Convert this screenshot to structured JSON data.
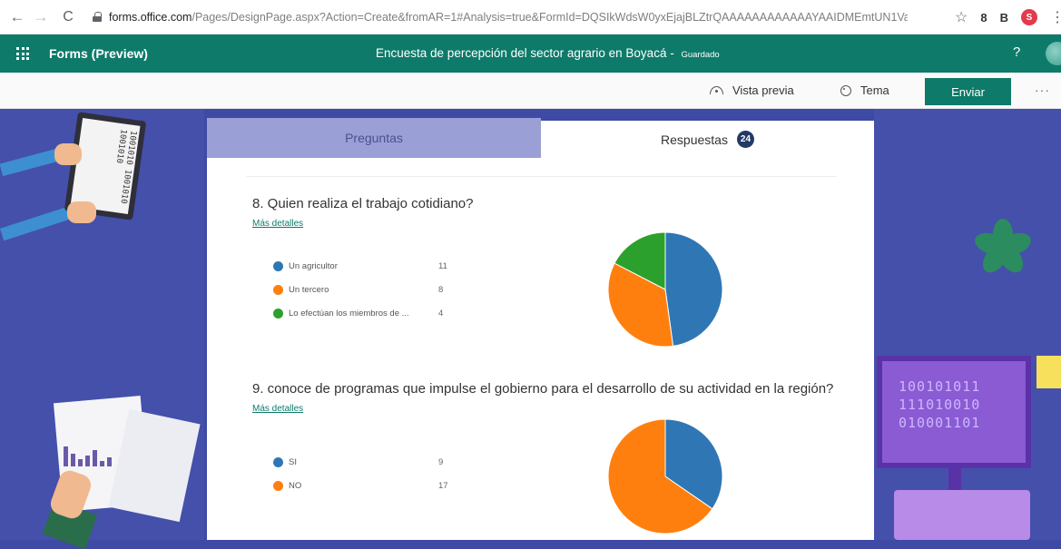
{
  "browser": {
    "url_host": "forms.office.com",
    "url_path": "/Pages/DesignPage.aspx?Action=Create&fromAR=1#Analysis=true&FormId=DQSIkWdsW0yxEjajBLZtrQAAAAAAAAAAAAYAAIDMEmtUN1VaTDhU...",
    "profile_initial": "S",
    "ext_label": "B"
  },
  "forms_bar": {
    "app_name": "Forms (Preview)",
    "title": "Encuesta de percepción del sector agrario en Boyacá",
    "separator": " - ",
    "saved": "Guardado",
    "help": "?"
  },
  "command_bar": {
    "preview": "Vista previa",
    "theme": "Tema",
    "send": "Enviar",
    "more": "···"
  },
  "tabs": {
    "questions": "Preguntas",
    "responses": "Respuestas",
    "responses_count": "24"
  },
  "decor": {
    "tablet_text": "1001010 1001010 1001010",
    "monitor_lines": [
      "100101011",
      "111010010",
      "010001101"
    ]
  },
  "questions": [
    {
      "title": "8.  Quien realiza el trabajo cotidiano?",
      "details_link": "Más detalles",
      "options": [
        {
          "label": "Un agricultor",
          "count": "11",
          "value": 11,
          "color": "#2f77b4"
        },
        {
          "label": "Un tercero",
          "count": "8",
          "value": 8,
          "color": "#ff7f0e"
        },
        {
          "label": "Lo efectúan los miembros de ...",
          "count": "4",
          "value": 4,
          "color": "#2ca02c"
        }
      ]
    },
    {
      "title": "9.  conoce de programas que impulse el gobierno para el desarrollo de su actividad en la región?",
      "details_link": "Más detalles",
      "options": [
        {
          "label": "SI",
          "count": "9",
          "value": 9,
          "color": "#2f77b4"
        },
        {
          "label": "NO",
          "count": "17",
          "value": 17,
          "color": "#ff7f0e"
        }
      ]
    }
  ]
}
